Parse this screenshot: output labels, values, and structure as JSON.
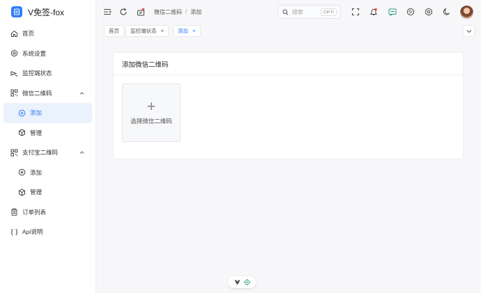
{
  "app": {
    "title": "V免签-fox"
  },
  "sidebar": {
    "items": [
      {
        "label": "首页",
        "icon": "home-icon"
      },
      {
        "label": "系统设置",
        "icon": "settings-icon"
      },
      {
        "label": "监控端状态",
        "icon": "monitor-icon"
      },
      {
        "label": "微信二维码",
        "icon": "qrcode-icon",
        "expanded": true,
        "children": [
          {
            "label": "添加",
            "icon": "plus-circle-icon",
            "active": true
          },
          {
            "label": "管理",
            "icon": "cube-icon"
          }
        ]
      },
      {
        "label": "支付宝二维码",
        "icon": "qrcode-icon",
        "expanded": true,
        "children": [
          {
            "label": "添加",
            "icon": "plus-circle-icon"
          },
          {
            "label": "管理",
            "icon": "cube-icon"
          }
        ]
      },
      {
        "label": "订单列表",
        "icon": "clipboard-icon"
      },
      {
        "label": "Api说明",
        "icon": "braces-icon"
      }
    ]
  },
  "header": {
    "breadcrumb": [
      "微信二维码",
      "添加"
    ],
    "breadcrumb_sep": "/",
    "search": {
      "placeholder": "搜索",
      "shortcut": "Ctrl K"
    }
  },
  "tabs": [
    {
      "label": "首页",
      "closable": false
    },
    {
      "label": "监控端状态",
      "closable": true
    },
    {
      "label": "添加",
      "closable": true,
      "active": true
    }
  ],
  "tab_close_glyph": "×",
  "main": {
    "card_title": "添加微信二维码",
    "upload": {
      "glyph": "+",
      "label": "选择微信二维码"
    }
  },
  "colors": {
    "accent": "#2f7df6",
    "active_bg": "#eaf2fe",
    "background": "#f7f7f9"
  }
}
